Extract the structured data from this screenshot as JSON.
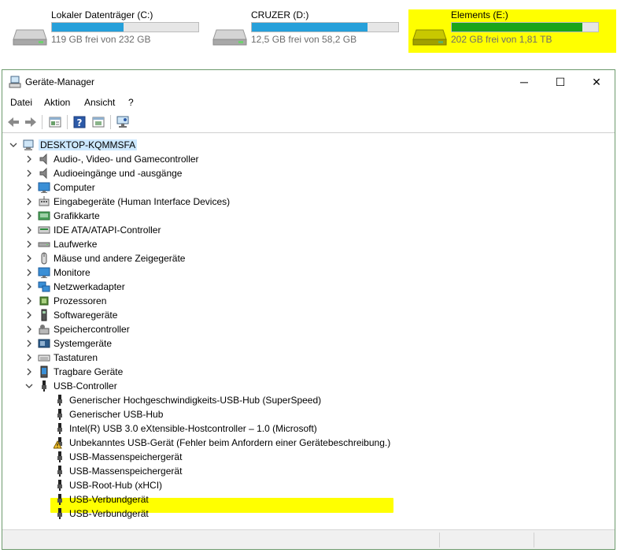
{
  "drives": [
    {
      "name": "Lokaler Datenträger (C:)",
      "free": "119 GB frei von 232 GB",
      "used_fraction": 0.49,
      "bar_color": "#26a0da"
    },
    {
      "name": "CRUZER (D:)",
      "free": "12,5 GB frei von 58,2 GB",
      "used_fraction": 0.79,
      "bar_color": "#26a0da"
    },
    {
      "name": "Elements (E:)",
      "free": "202 GB frei von 1,81 TB",
      "used_fraction": 0.89,
      "bar_color": "#1aa51a"
    }
  ],
  "highlight_color": "#ffff00",
  "window": {
    "title": "Geräte-Manager",
    "controls": {
      "minimize": "─",
      "maximize": "☐",
      "close": "✕"
    }
  },
  "menu": [
    "Datei",
    "Aktion",
    "Ansicht",
    "?"
  ],
  "toolbar": [
    "back-icon",
    "forward-icon",
    "properties-icon",
    "help-icon",
    "show-hidden-icon",
    "scan-hardware-icon"
  ],
  "tree": {
    "root": "DESKTOP-KQMMSFA",
    "categories": [
      "Audio-, Video- und Gamecontroller",
      "Audioeingänge und -ausgänge",
      "Computer",
      "Eingabegeräte (Human Interface Devices)",
      "Grafikkarte",
      "IDE ATA/ATAPI-Controller",
      "Laufwerke",
      "Mäuse und andere Zeigegeräte",
      "Monitore",
      "Netzwerkadapter",
      "Prozessoren",
      "Softwaregeräte",
      "Speichercontroller",
      "Systemgeräte",
      "Tastaturen",
      "Tragbare Geräte",
      "USB-Controller"
    ],
    "usb_children": [
      "Generischer Hochgeschwindigkeits-USB-Hub (SuperSpeed)",
      "Generischer USB-Hub",
      "Intel(R) USB 3.0 eXtensible-Hostcontroller – 1.0 (Microsoft)",
      "Unbekanntes USB-Gerät (Fehler beim Anfordern einer Gerätebeschreibung.)",
      "USB-Massenspeichergerät",
      "USB-Massenspeichergerät",
      "USB-Root-Hub (xHCI)",
      "USB-Verbundgerät",
      "USB-Verbundgerät"
    ],
    "warning_child_index": 3
  }
}
